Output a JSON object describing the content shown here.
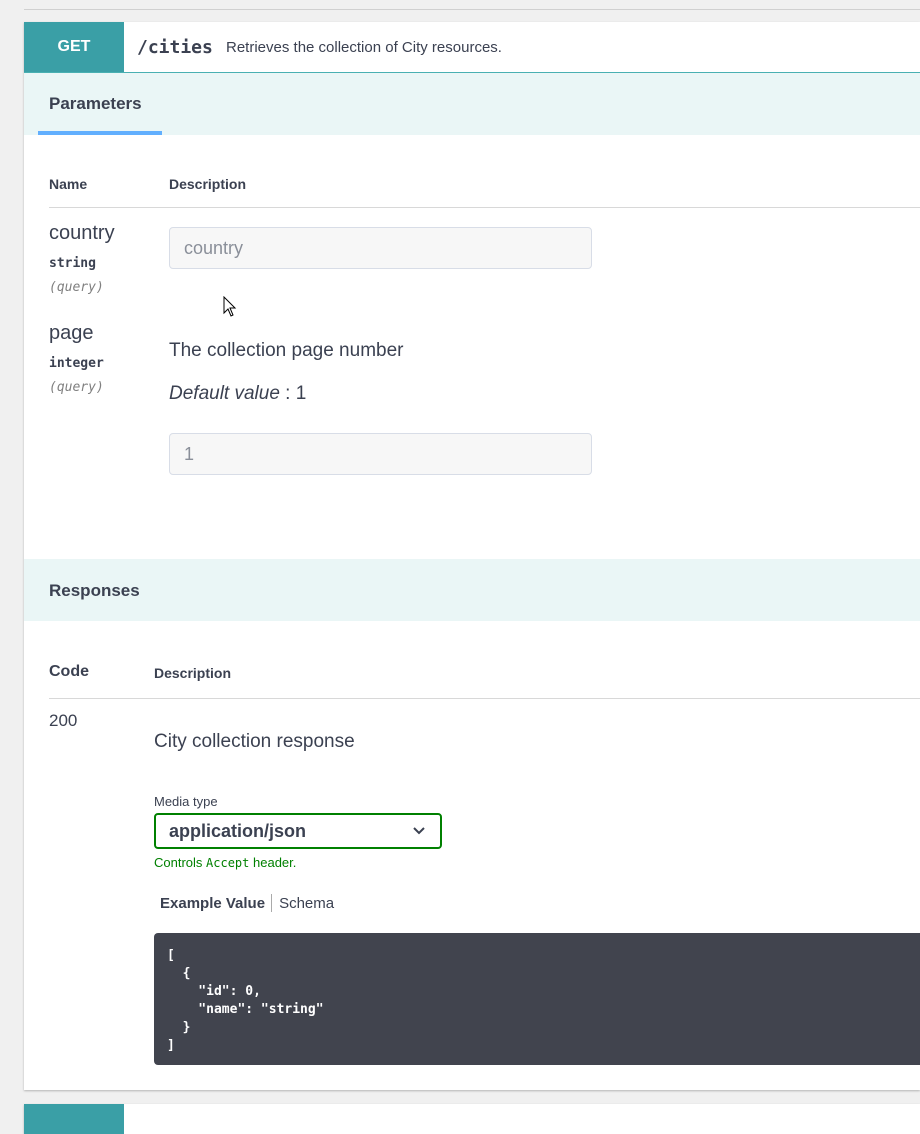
{
  "operation": {
    "method": "GET",
    "path": "/cities",
    "summary": "Retrieves the collection of City resources."
  },
  "parameters": {
    "tab_label": "Parameters",
    "col_name": "Name",
    "col_description": "Description",
    "items": [
      {
        "name": "country",
        "type": "string",
        "in": "(query)",
        "placeholder": "country",
        "value": ""
      },
      {
        "name": "page",
        "type": "integer",
        "in": "(query)",
        "description": "The collection page number",
        "default_label": "Default value",
        "default_sep": " : ",
        "default_value": "1",
        "placeholder": "1",
        "value": ""
      }
    ]
  },
  "responses": {
    "title": "Responses",
    "col_code": "Code",
    "col_description": "Description",
    "items": [
      {
        "code": "200",
        "description": "City collection response",
        "media_type_label": "Media type",
        "media_type": "application/json",
        "controls_prefix": "Controls ",
        "controls_code": "Accept",
        "controls_suffix": " header.",
        "tab_example": "Example Value",
        "tab_schema": "Schema",
        "example": "[\n  {\n    \"id\": 0,\n    \"name\": \"string\"\n  }\n]"
      }
    ]
  },
  "colors": {
    "get_method": "#3a9fa6",
    "section_bg": "#eaf6f6",
    "select_border": "#008000",
    "code_bg": "#41444e"
  }
}
